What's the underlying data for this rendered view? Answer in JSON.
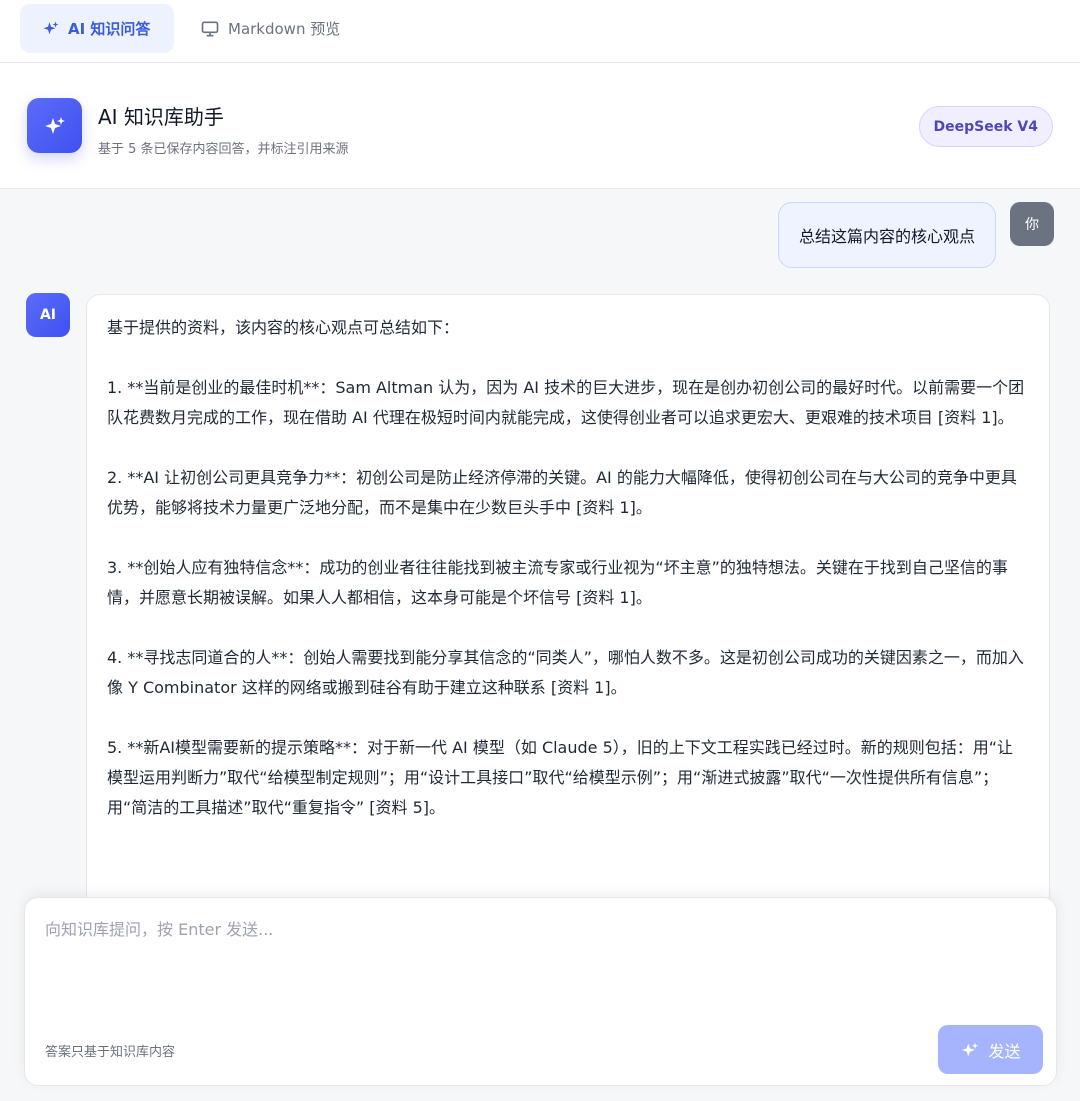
{
  "tabs": [
    {
      "label": "AI 知识问答",
      "icon": "sparkles-icon",
      "active": true
    },
    {
      "label": "Markdown 预览",
      "icon": "monitor-icon",
      "active": false
    }
  ],
  "header": {
    "title": "AI 知识库助手",
    "subtitle": "基于 5 条已保存内容回答，并标注引用来源",
    "model": "DeepSeek V4"
  },
  "chat": {
    "user_avatar": "你",
    "user_message": "总结这篇内容的核心观点",
    "ai_avatar": "AI",
    "ai_paragraphs": [
      "基于提供的资料，该内容的核心观点可总结如下：",
      "1. **当前是创业的最佳时机**：Sam Altman 认为，因为 AI 技术的巨大进步，现在是创办初创公司的最好时代。以前需要一个团队花费数月完成的工作，现在借助 AI 代理在极短时间内就能完成，这使得创业者可以追求更宏大、更艰难的技术项目 [资料 1]。",
      "2. **AI 让初创公司更具竞争力**：初创公司是防止经济停滞的关键。AI 的能力大幅降低，使得初创公司在与大公司的竞争中更具优势，能够将技术力量更广泛地分配，而不是集中在少数巨头手中 [资料 1]。",
      "3. **创始人应有独特信念**：成功的创业者往往能找到被主流专家或行业视为“坏主意”的独特想法。关键在于找到自己坚信的事情，并愿意长期被误解。如果人人都相信，这本身可能是个坏信号 [资料 1]。",
      "4. **寻找志同道合的人**：创始人需要找到能分享其信念的“同类人”，哪怕人数不多。这是初创公司成功的关键因素之一，而加入像 Y Combinator 这样的网络或搬到硅谷有助于建立这种联系 [资料 1]。",
      "5. **新AI模型需要新的提示策略**：对于新一代 AI 模型（如 Claude 5），旧的上下文工程实践已经过时。新的规则包括：用“让模型运用判断力”取代“给模型制定规则”；用“设计工具接口”取代“给模型示例”；用“渐进式披露”取代“一次性提供所有信息”；用“简洁的工具描述”取代“重复指令” [资料 5]。"
    ]
  },
  "input": {
    "placeholder": "向知识库提问，按 Enter 发送...",
    "value": "",
    "hint": "答案只基于知识库内容",
    "send_label": "发送"
  },
  "colors": {
    "accent": "#4f5cf5",
    "active_tab_bg": "#eef2ff",
    "send_button": "#a5b4fc",
    "model_badge_bg": "#f1efff"
  }
}
